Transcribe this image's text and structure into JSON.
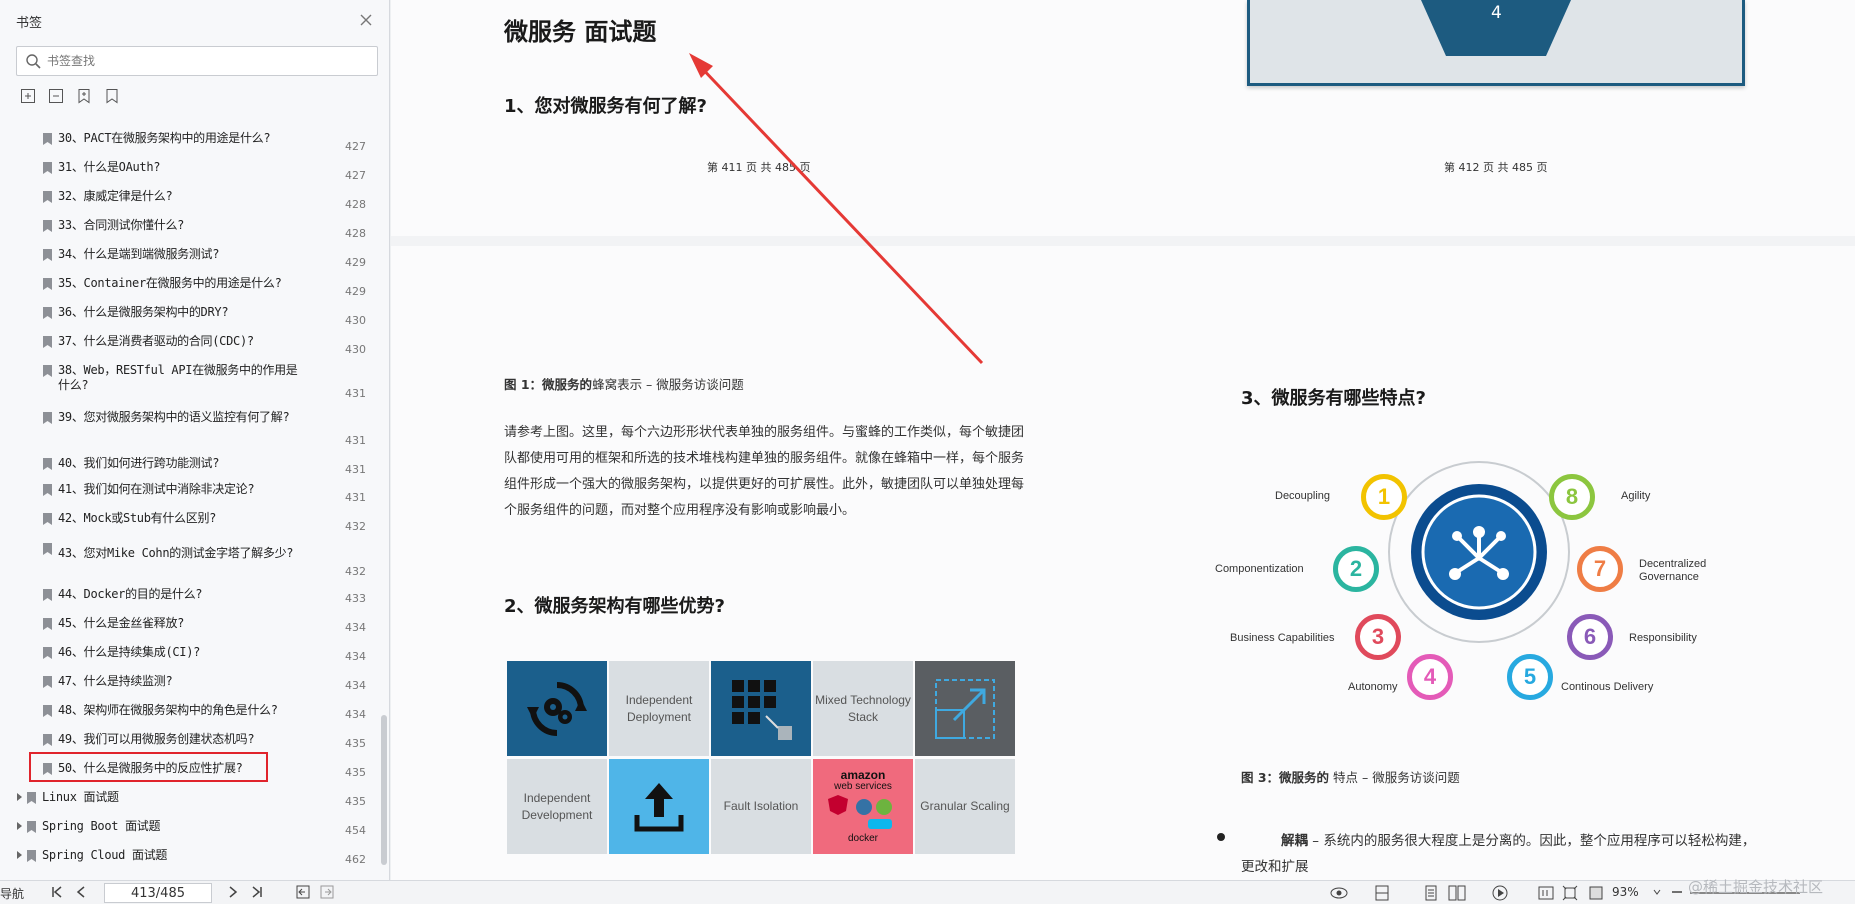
{
  "sidebar": {
    "title": "书签",
    "search_placeholder": "书签查找",
    "bookmarks": [
      {
        "label": "30、PACT在微服务架构中的用途是什么?",
        "page": "427"
      },
      {
        "label": "31、什么是OAuth?",
        "page": "427"
      },
      {
        "label": "32、康威定律是什么?",
        "page": "428"
      },
      {
        "label": "33、合同测试你懂什么?",
        "page": "428"
      },
      {
        "label": "34、什么是端到端微服务测试?",
        "page": "429"
      },
      {
        "label": "35、Container在微服务中的用途是什么?",
        "page": "429"
      },
      {
        "label": "36、什么是微服务架构中的DRY?",
        "page": "430"
      },
      {
        "label": "37、什么是消费者驱动的合同(CDC)?",
        "page": "430"
      },
      {
        "label": "38、Web，RESTful API在微服务中的作用是什么?",
        "page": "431"
      },
      {
        "label": "39、您对微服务架构中的语义监控有何了解?",
        "page": "431"
      },
      {
        "label": "40、我们如何进行跨功能测试?",
        "page": "431"
      },
      {
        "label": "41、我们如何在测试中消除非决定论?",
        "page": "431"
      },
      {
        "label": "42、Mock或Stub有什么区别?",
        "page": "432"
      },
      {
        "label": "43、您对Mike Cohn的测试金字塔了解多少?",
        "page": "432"
      },
      {
        "label": "44、Docker的目的是什么?",
        "page": "433"
      },
      {
        "label": "45、什么是金丝雀释放?",
        "page": "434"
      },
      {
        "label": "46、什么是持续集成(CI)?",
        "page": "434"
      },
      {
        "label": "47、什么是持续监测?",
        "page": "434"
      },
      {
        "label": "48、架构师在微服务架构中的角色是什么?",
        "page": "434"
      },
      {
        "label": "49、我们可以用微服务创建状态机吗?",
        "page": "435"
      },
      {
        "label": "50、什么是微服务中的反应性扩展?",
        "page": "435"
      }
    ],
    "sections": [
      {
        "label": "Linux 面试题",
        "page": "435"
      },
      {
        "label": "Spring Boot 面试题",
        "page": "454"
      },
      {
        "label": "Spring Cloud 面试题",
        "page": "462"
      }
    ]
  },
  "doc": {
    "top_title": "微服务 面试题",
    "q1": "1、您对微服务有何了解?",
    "footer_left": "第 411 页 共 485 页",
    "footer_right": "第 412 页 共 485 页",
    "hex_number": "4",
    "fig1_caption_bold": "图 1：微服务的",
    "fig1_caption_rest": "蜂窝表示 – 微服务访谈问题",
    "para1": "请参考上图。这里，每个六边形形状代表单独的服务组件。与蜜蜂的工作类似，每个敏捷团队都使用可用的框架和所选的技术堆栈构建单独的服务组件。就像在蜂箱中一样，每个服务组件形成一个强大的微服务架构，以提供更好的可扩展性。此外，敏捷团队可以单独处理每个服务组件的问题，而对整个应用程序没有影响或影响最小。",
    "q2": "2、微服务架构有哪些优势?",
    "q3": "3、微服务有哪些特点?",
    "fig3_caption_bold": "图 3：微服务的",
    "fig3_caption_rest": "特点 – 微服务访谈问题",
    "bullet_bold": "解耦",
    "bullet_rest": " – 系统内的服务很大程度上是分离的。因此，整个应用程序可以轻松构建，更改和扩展",
    "benefits": {
      "independent_deployment": "Independent Deployment",
      "mixed_stack": "Mixed Technology Stack",
      "independent_development": "Independent Development",
      "fault_isolation": "Fault Isolation",
      "granular_scaling": "Granular Scaling",
      "amazon": "amazon",
      "web_services": "web services",
      "docker": "docker"
    },
    "characteristics": [
      {
        "n": "1",
        "label": "Decoupling"
      },
      {
        "n": "2",
        "label": "Componentization"
      },
      {
        "n": "3",
        "label": "Business Capabilities"
      },
      {
        "n": "4",
        "label": "Autonomy"
      },
      {
        "n": "5",
        "label": "Continous Delivery"
      },
      {
        "n": "6",
        "label": "Responsibility"
      },
      {
        "n": "7",
        "label": "Decentralized Governance"
      },
      {
        "n": "8",
        "label": "Agility"
      }
    ]
  },
  "statusbar": {
    "nav_label": "导航",
    "page_value": "413/485",
    "zoom": "93%"
  },
  "watermark": "@稀土掘金技术社区",
  "colors": {
    "highlight": "#e0242c",
    "arrow": "#e53935",
    "hex_blue": "#1d5b80"
  }
}
